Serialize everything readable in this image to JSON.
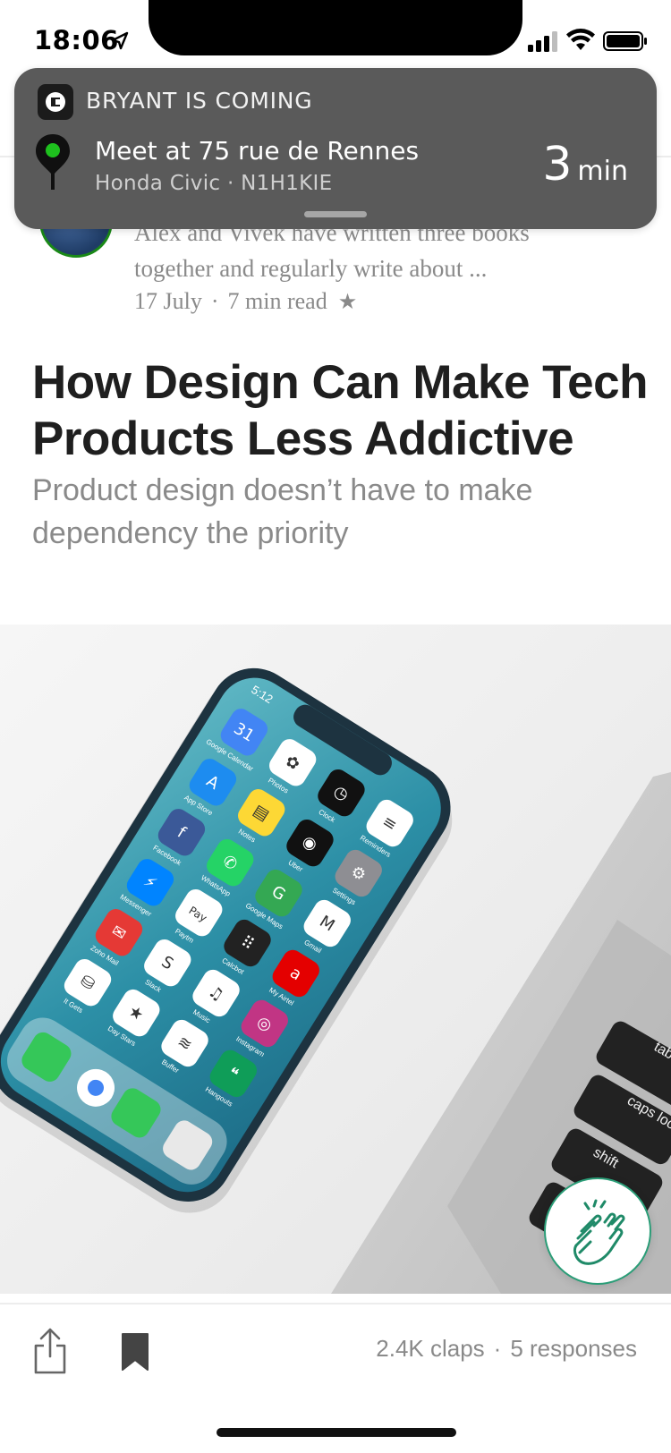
{
  "status_bar": {
    "time": "18:06"
  },
  "notification": {
    "title": "BRYANT IS COMING",
    "line1": "Meet at 75 rue de Rennes",
    "line2": "Honda Civic · N1H1KIE",
    "eta_value": "3",
    "eta_unit": "min",
    "app_icon": "uber-app-icon",
    "pin_icon": "map-pin-icon"
  },
  "author_card": {
    "snippet_line1": "Alex and Vivek have written three books",
    "snippet_line2": "together and regularly write about ...",
    "date": "17 July",
    "separator": "·",
    "read_time": "7 min read",
    "star": "★"
  },
  "article": {
    "title": "How Design Can Make Tech Products Less Addictive",
    "subtitle": "Product design doesn’t have to make dependency the priority"
  },
  "hero_image": {
    "phone_time": "5:12",
    "apps": [
      {
        "label": "Google Calendar",
        "glyph": "31",
        "color": "#4285f4"
      },
      {
        "label": "Photos",
        "glyph": "✿",
        "color": "#ffffff"
      },
      {
        "label": "Clock",
        "glyph": "◷",
        "color": "#111111"
      },
      {
        "label": "Reminders",
        "glyph": "≡",
        "color": "#ffffff"
      },
      {
        "label": "App Store",
        "glyph": "A",
        "color": "#1d8cf0"
      },
      {
        "label": "Notes",
        "glyph": "▤",
        "color": "#fdd835"
      },
      {
        "label": "Uber",
        "glyph": "◉",
        "color": "#111111"
      },
      {
        "label": "Settings",
        "glyph": "⚙",
        "color": "#8e8e93"
      },
      {
        "label": "Facebook",
        "glyph": "f",
        "color": "#3b5998"
      },
      {
        "label": "WhatsApp",
        "glyph": "✆",
        "color": "#25d366"
      },
      {
        "label": "Google Maps",
        "glyph": "G",
        "color": "#34a853"
      },
      {
        "label": "Gmail",
        "glyph": "M",
        "color": "#ffffff"
      },
      {
        "label": "Messenger",
        "glyph": "⚡",
        "color": "#0084ff"
      },
      {
        "label": "Paytm",
        "glyph": "Pay",
        "color": "#ffffff"
      },
      {
        "label": "Calcbot",
        "glyph": "⠿",
        "color": "#222222"
      },
      {
        "label": "My Airtel",
        "glyph": "a",
        "color": "#e40000"
      },
      {
        "label": "Zoho Mail",
        "glyph": "✉",
        "color": "#e53935"
      },
      {
        "label": "Slack",
        "glyph": "S",
        "color": "#ffffff"
      },
      {
        "label": "Music",
        "glyph": "♫",
        "color": "#ffffff"
      },
      {
        "label": "Instagram",
        "glyph": "◎",
        "color": "#c13584"
      },
      {
        "label": "It Gets",
        "glyph": "⛁",
        "color": "#ffffff"
      },
      {
        "label": "Day Stars",
        "glyph": "★",
        "color": "#ffffff"
      },
      {
        "label": "Buffer",
        "glyph": "≋",
        "color": "#ffffff"
      },
      {
        "label": "Hangouts",
        "glyph": "❝",
        "color": "#0f9d58"
      }
    ],
    "keyboard_keys": [
      "tab",
      "caps lock",
      "shift"
    ]
  },
  "clap_button": {
    "icon": "clap-icon"
  },
  "toolbar": {
    "claps": "2.4K claps",
    "separator": "·",
    "responses": "5 responses",
    "share_icon": "share-icon",
    "bookmark_icon": "bookmark-icon"
  },
  "colors": {
    "notification_bg": "#5a5a5a",
    "accent_green": "#2a9d77",
    "pin_green": "#1ec11e",
    "muted_text": "#8a8a8a",
    "headline_text": "#1f1f1f"
  }
}
